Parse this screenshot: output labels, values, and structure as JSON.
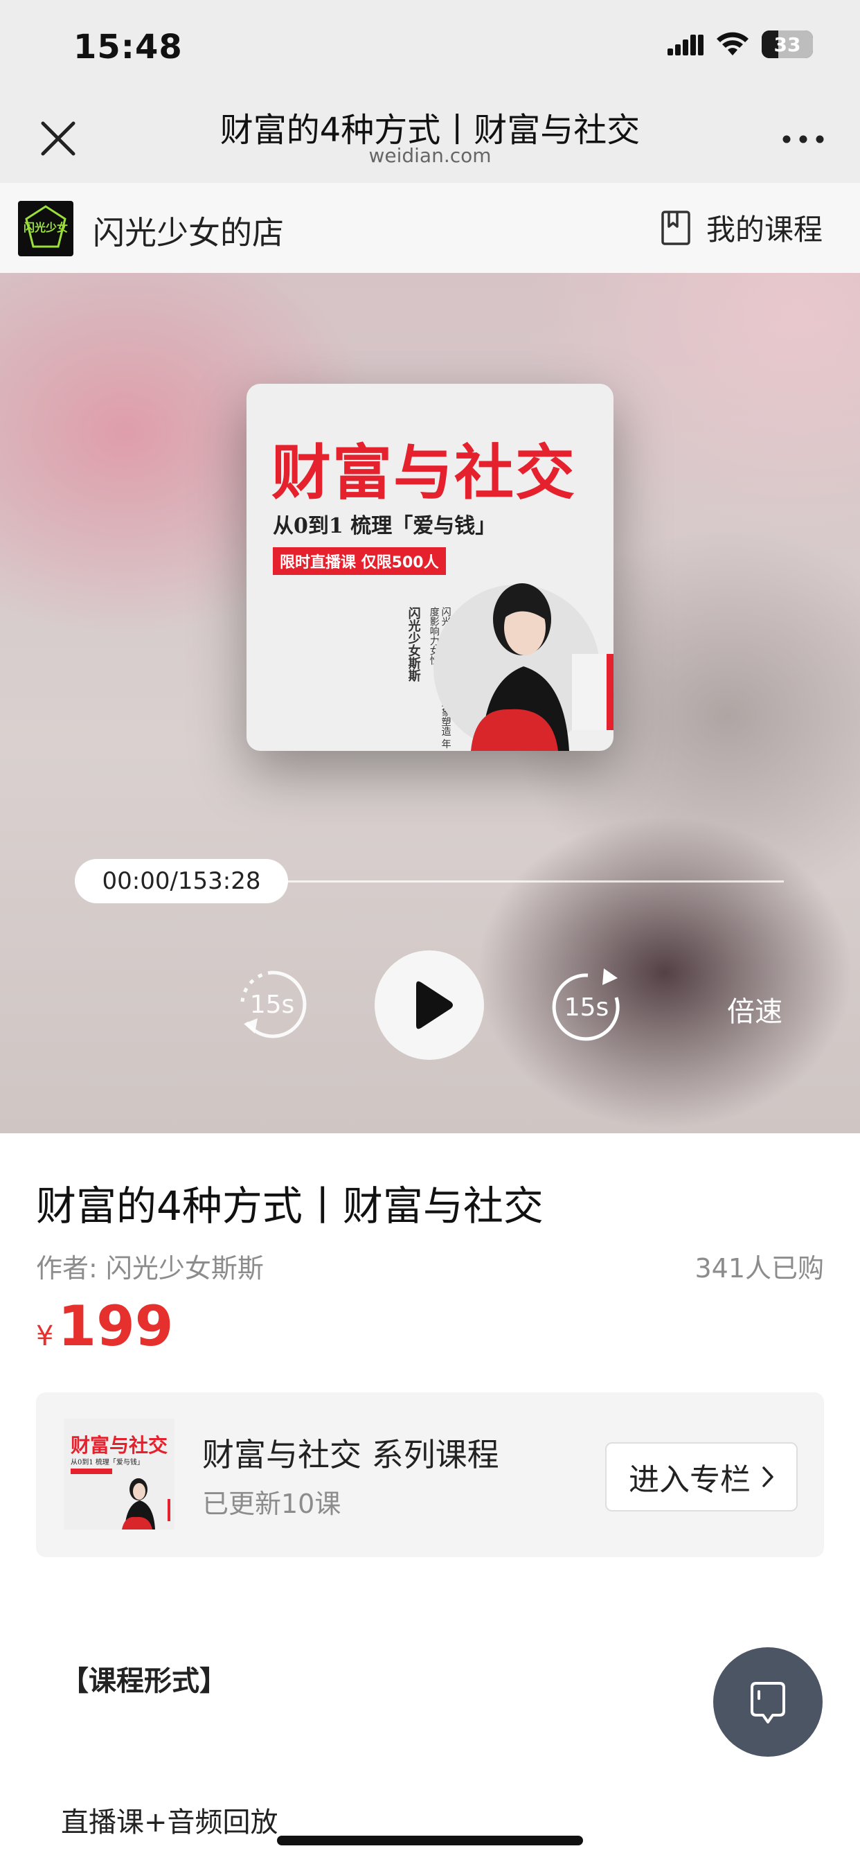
{
  "status_bar": {
    "time": "15:48",
    "battery": "33"
  },
  "nav": {
    "title": "财富的4种方式丨财富与社交",
    "domain": "weidian.com"
  },
  "shop": {
    "name": "闪光少女的店",
    "logo_text": "闪光少女",
    "my_courses": "我的课程"
  },
  "cover": {
    "title": "财富与社交",
    "subtitle": "从0到1 梳理「爱与钱」",
    "tag": "限时直播课 仅限500人",
    "vertical_name": "闪光少女斯斯",
    "vertical_bio": "闪光少女创始人 专业形象塑造 年度影响力女性"
  },
  "player": {
    "time": "00:00/153:28",
    "rewind_label": "15s",
    "forward_label": "15s",
    "speed_label": "倍速",
    "progress": 0
  },
  "course": {
    "title": "财富的4种方式丨财富与社交",
    "author": "作者: 闪光少女斯斯",
    "buyers": "341人已购",
    "currency": "¥",
    "price": "199"
  },
  "series": {
    "title": "财富与社交  系列课程",
    "count": "已更新10课",
    "thumb_title": "财富与社交",
    "thumb_sub": "从0到1 梳理「爱与钱」",
    "enter_label": "进入专栏"
  },
  "content": {
    "section_heading": "【课程形式】",
    "section_text": "直播课+音频回放"
  },
  "colors": {
    "accent_red": "#e5302e",
    "fab": "#4b5563"
  }
}
